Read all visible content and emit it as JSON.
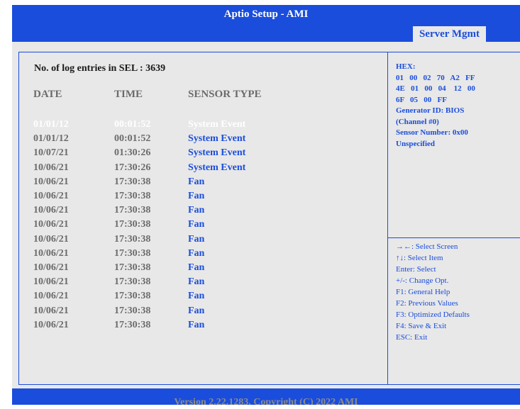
{
  "window": {
    "title": "Aptio Setup - AMI",
    "active_tab": "Server Mgmt"
  },
  "log": {
    "count_label": "No. of log entries in SEL : 3639",
    "headers": {
      "date": "DATE",
      "time": "TIME",
      "type": "SENSOR TYPE"
    },
    "rows": [
      {
        "date": "01/01/12",
        "time": "00:01:52",
        "type": "System Event"
      },
      {
        "date": "01/01/12",
        "time": "00:01:52",
        "type": "System Event"
      },
      {
        "date": "10/07/21",
        "time": "01:30:26",
        "type": "System Event"
      },
      {
        "date": "10/06/21",
        "time": "17:30:26",
        "type": "System Event"
      },
      {
        "date": "10/06/21",
        "time": "17:30:38",
        "type": "Fan"
      },
      {
        "date": "10/06/21",
        "time": "17:30:38",
        "type": "Fan"
      },
      {
        "date": "10/06/21",
        "time": "17:30:38",
        "type": "Fan"
      },
      {
        "date": "10/06/21",
        "time": "17:30:38",
        "type": "Fan"
      },
      {
        "date": "10/06/21",
        "time": "17:30:38",
        "type": "Fan"
      },
      {
        "date": "10/06/21",
        "time": "17:30:38",
        "type": "Fan"
      },
      {
        "date": "10/06/21",
        "time": "17:30:38",
        "type": "Fan"
      },
      {
        "date": "10/06/21",
        "time": "17:30:38",
        "type": "Fan"
      },
      {
        "date": "10/06/21",
        "time": "17:30:38",
        "type": "Fan"
      },
      {
        "date": "10/06/21",
        "time": "17:30:38",
        "type": "Fan"
      },
      {
        "date": "10/06/21",
        "time": "17:30:38",
        "type": "Fan"
      }
    ]
  },
  "detail": {
    "hex_label": "HEX:",
    "hex_rows": [
      "01   00   02   70   A2   FF",
      "4E   01   00   04    12   00",
      "6F   05   00   FF"
    ],
    "generator": "Generator ID: BIOS",
    "channel": "(Channel #0)",
    "sensor_number": "Sensor Number: 0x00",
    "unspecified": "Unspecified"
  },
  "help": [
    "→←: Select Screen",
    "↑↓: Select Item",
    "Enter: Select",
    "+/-: Change Opt.",
    "F1: General Help",
    "F2: Previous Values",
    "F3: Optimized Defaults",
    "F4: Save & Exit",
    "ESC: Exit"
  ],
  "footer": "Version 2.22.1283. Copyright (C) 2022 AMI",
  "colors": {
    "accent": "#1a4ddb",
    "background": "#e8e8e8",
    "muted_text": "#6b6b6b"
  }
}
